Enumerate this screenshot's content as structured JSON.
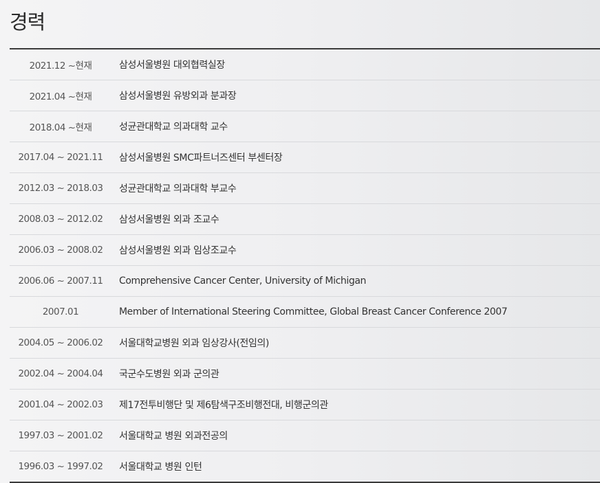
{
  "section": {
    "title": "경력"
  },
  "career": [
    {
      "period": "2021.12 ~현재",
      "desc": "삼성서울병원 대외협력실장"
    },
    {
      "period": "2021.04 ~현재",
      "desc": "삼성서울병원 유방외과 분과장"
    },
    {
      "period": "2018.04 ~현재",
      "desc": "성균관대학교 의과대학 교수"
    },
    {
      "period": "2017.04 ~ 2021.11",
      "desc": "삼성서울병원 SMC파트너즈센터 부센터장"
    },
    {
      "period": "2012.03 ~ 2018.03",
      "desc": "성균관대학교 의과대학 부교수"
    },
    {
      "period": "2008.03 ~ 2012.02",
      "desc": "삼성서울병원 외과 조교수"
    },
    {
      "period": "2006.03 ~ 2008.02",
      "desc": "삼성서울병원 외과 임상조교수"
    },
    {
      "period": "2006.06 ~ 2007.11",
      "desc": "Comprehensive Cancer Center, University of Michigan"
    },
    {
      "period": "2007.01",
      "desc": "Member of International Steering Committee, Global Breast Cancer Conference 2007"
    },
    {
      "period": "2004.05 ~ 2006.02",
      "desc": "서울대학교병원 외과 임상강사(전임의)"
    },
    {
      "period": "2002.04 ~ 2004.04",
      "desc": "국군수도병원 외과 군의관"
    },
    {
      "period": "2001.04 ~ 2002.03",
      "desc": "제17전투비행단 및 제6탐색구조비행전대, 비행군의관"
    },
    {
      "period": "1997.03 ~ 2001.02",
      "desc": "서울대학교 병원 외과전공의"
    },
    {
      "period": "1996.03 ~ 1997.02",
      "desc": "서울대학교 병원 인턴"
    }
  ]
}
